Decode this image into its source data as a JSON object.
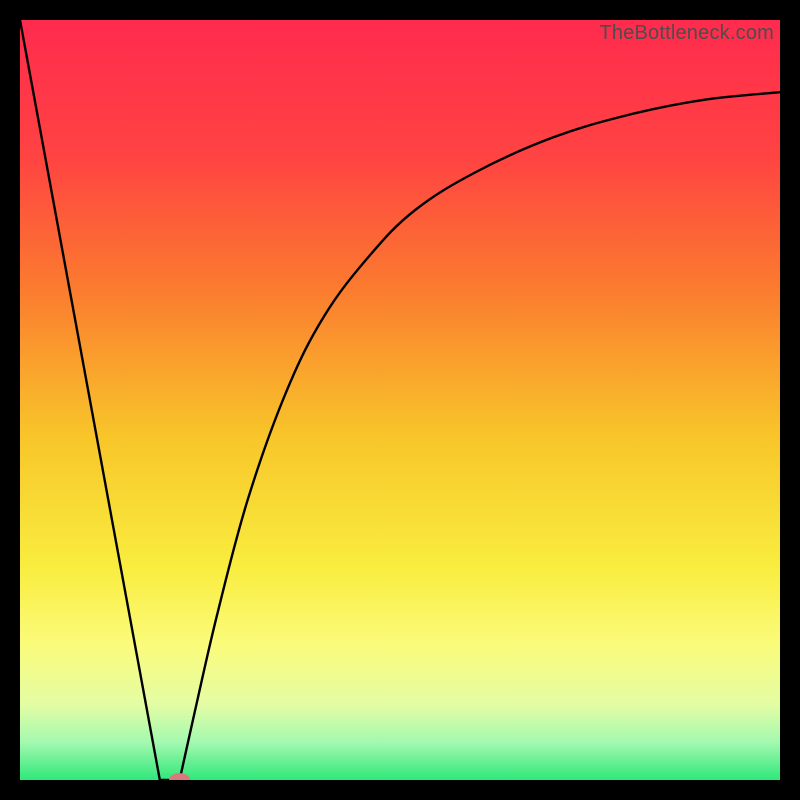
{
  "watermark": "TheBottleneck.com",
  "chart_data": {
    "type": "line",
    "title": "",
    "xlabel": "",
    "ylabel": "",
    "xlim": [
      0,
      100
    ],
    "ylim": [
      0,
      100
    ],
    "grid": false,
    "legend": false,
    "background_gradient_stops": [
      {
        "offset": 0,
        "color": "#ff2b4e"
      },
      {
        "offset": 0.18,
        "color": "#ff4342"
      },
      {
        "offset": 0.35,
        "color": "#fb7a2f"
      },
      {
        "offset": 0.55,
        "color": "#f8c62a"
      },
      {
        "offset": 0.72,
        "color": "#f9ed3f"
      },
      {
        "offset": 0.82,
        "color": "#fbfb7a"
      },
      {
        "offset": 0.9,
        "color": "#e4fda4"
      },
      {
        "offset": 0.95,
        "color": "#a4f9b0"
      },
      {
        "offset": 1.0,
        "color": "#2fe87a"
      }
    ],
    "series": [
      {
        "name": "left-descending-line",
        "segment": "line",
        "x": [
          0,
          18.4
        ],
        "y": [
          100,
          0
        ]
      },
      {
        "name": "valley-flat",
        "segment": "line",
        "x": [
          18.4,
          21.0
        ],
        "y": [
          0,
          0
        ]
      },
      {
        "name": "right-rising-curve",
        "segment": "curve",
        "x": [
          21.0,
          23,
          26,
          30,
          35,
          40,
          46,
          52,
          60,
          70,
          80,
          90,
          100
        ],
        "y": [
          0,
          9,
          22,
          37,
          51,
          61,
          69,
          75,
          80,
          84.5,
          87.5,
          89.5,
          90.5
        ]
      }
    ],
    "marker": {
      "name": "min-point-marker",
      "x": 21.0,
      "y": 0,
      "rx": 1.4,
      "ry": 0.9,
      "color": "#d87a7e"
    }
  }
}
